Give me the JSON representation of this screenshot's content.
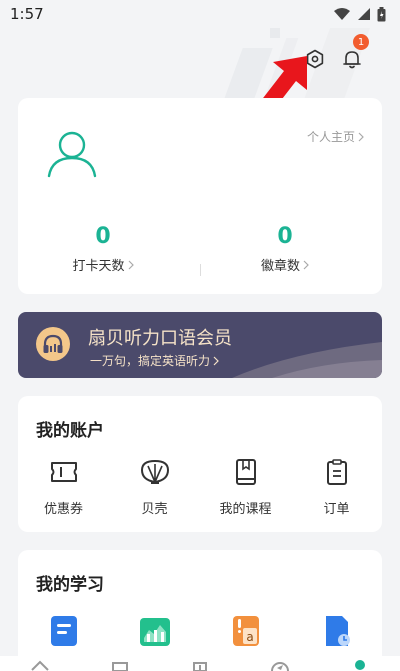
{
  "status_bar": {
    "time": "1:57"
  },
  "header": {
    "notification_count": "1"
  },
  "profile": {
    "home_link": "个人主页",
    "stats": [
      {
        "value": "0",
        "label": "打卡天数"
      },
      {
        "value": "0",
        "label": "徽章数"
      }
    ]
  },
  "vip": {
    "title": "扇贝听力口语会员",
    "subtitle": "一万句，搞定英语听力"
  },
  "account": {
    "title": "我的账户",
    "items": [
      {
        "label": "优惠券",
        "icon": "coupon-icon"
      },
      {
        "label": "贝壳",
        "icon": "shell-icon"
      },
      {
        "label": "我的课程",
        "icon": "book-icon"
      },
      {
        "label": "订单",
        "icon": "order-icon"
      }
    ]
  },
  "study": {
    "title": "我的学习",
    "items": [
      {
        "icon": "notes-icon"
      },
      {
        "icon": "stats-icon"
      },
      {
        "icon": "vocab-icon"
      },
      {
        "icon": "file-icon"
      }
    ]
  },
  "colors": {
    "accent": "#1bb394",
    "vip_bg": "#4b4a6b",
    "badge": "#f25c2e",
    "arrow": "#e8161c"
  }
}
